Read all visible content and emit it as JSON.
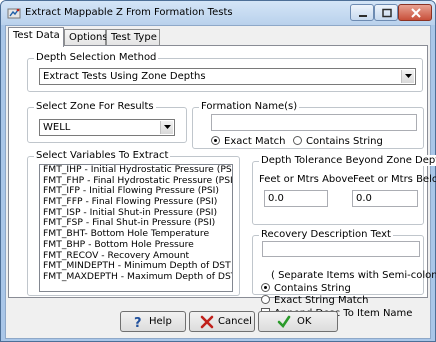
{
  "window": {
    "title": "Extract Mappable Z From Formation Tests",
    "icon": "window-icon",
    "controls": [
      "minimize-icon",
      "maximize-icon",
      "close-icon"
    ]
  },
  "tabs": [
    {
      "label": "Test Data",
      "active": true
    },
    {
      "label": "Options",
      "active": false
    },
    {
      "label": "Test Type",
      "active": false
    }
  ],
  "depth_selection": {
    "label": "Depth Selection Method",
    "value": "Extract Tests Using Zone Depths"
  },
  "zone": {
    "label": "Select Zone For Results",
    "value": "WELL"
  },
  "formation": {
    "label": "Formation Name(s)",
    "value": "",
    "exact_match": "Exact Match",
    "contains_string": "Contains String",
    "selected": "exact_match"
  },
  "variables": {
    "label": "Select Variables To Extract",
    "items": [
      "FMT_IHP - Initial Hydrostatic Pressure (PSI)",
      "FMT_FHP - Final Hydrostatic Pressure (PSI)",
      "FMT_IFP - Initial Flowing Pressure (PSI)",
      "FMT_FFP - Final Flowing Pressure (PSI)",
      "FMT_ISP - Initial Shut-in Pressure (PSI)",
      "FMT_FSP - Final Shut-in Pressure (PSI)",
      "FMT_BHT- Bottom Hole Temperature",
      "FMT_BHP - Bottom Hole Pressure",
      "FMT_RECOV - Recovery Amount",
      "FMT_MINDEPTH - Minimum Depth of DST",
      "FMT_MAXDEPTH - Maximum Depth of DST"
    ]
  },
  "tolerance": {
    "label": "Depth Tolerance Beyond Zone Depths",
    "above_label": "Feet or Mtrs Above",
    "below_label": "Feet or Mtrs Below",
    "above_value": "0.0",
    "below_value": "0.0"
  },
  "recovery": {
    "label": "Recovery Description Text",
    "value": "",
    "note": "( Separate Items with Semi-colon )",
    "contains_string": "Contains String",
    "exact_string_match": "Exact String Match",
    "selected": "contains_string",
    "append_label": "Append Desc To Item Name",
    "append_checked": false
  },
  "buttons": {
    "help": "Help",
    "cancel": "Cancel",
    "ok": "OK"
  },
  "colors": {
    "title_bar": "#b9d1ec",
    "close_button": "#c8503a",
    "help_icon": "#1f4f9c",
    "cancel_icon": "#c0201a",
    "ok_icon": "#2a9a2a"
  }
}
